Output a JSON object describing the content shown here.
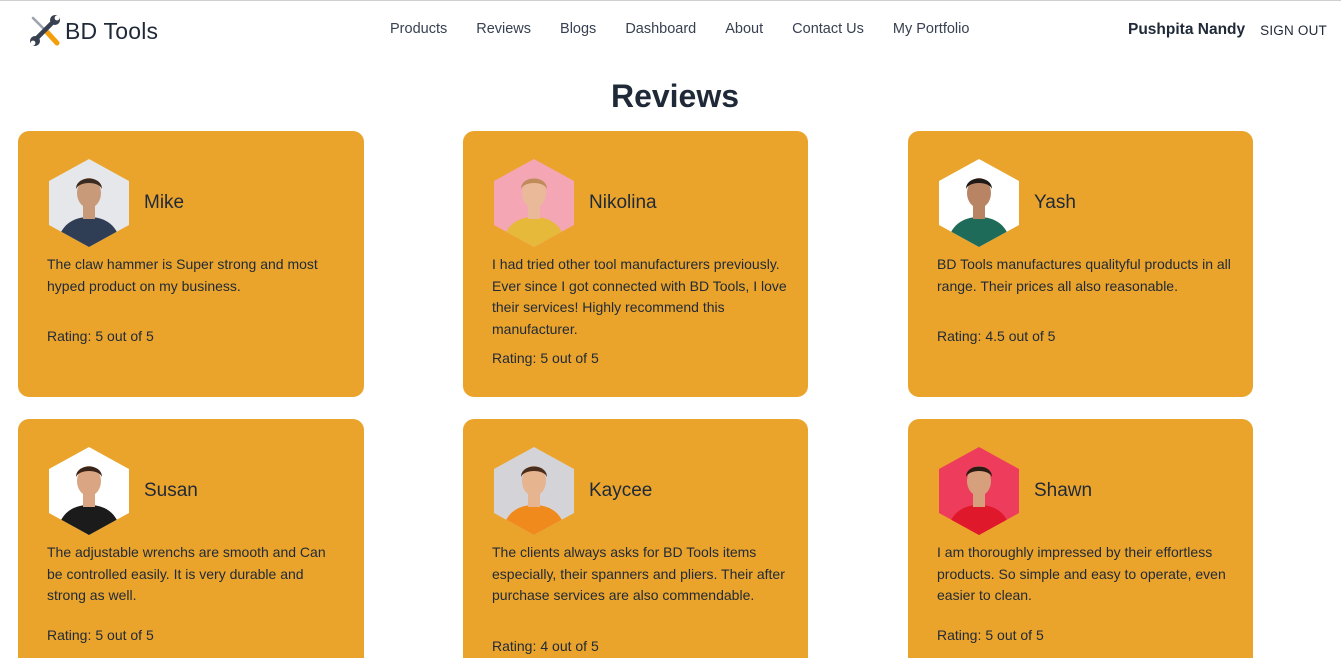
{
  "brand": {
    "name": "BD Tools",
    "logo_icon": "wrench-screwdriver-icon"
  },
  "nav": {
    "links": [
      "Products",
      "Reviews",
      "Blogs",
      "Dashboard",
      "About",
      "Contact Us",
      "My Portfolio"
    ],
    "user_name": "Pushpita Nandy",
    "signout_label": "SIGN OUT"
  },
  "page_title": "Reviews",
  "colors": {
    "card_bg": "#eba42b",
    "text": "#1f2937"
  },
  "reviews": [
    {
      "name": "Mike",
      "text": "The claw hammer is Super strong and most hyped product on my business.",
      "rating_label": "Rating:",
      "rating_value": "5 out of 5",
      "avatar_bg": "#e5e7eb",
      "shirt": "#2f3d55",
      "skin": "#c89a7a",
      "hair": "#3b2a1f"
    },
    {
      "name": "Nikolina",
      "text": "I had tried other tool manufacturers previously. Ever since I got connected with BD Tools, I love their services! Highly recommend this manufacturer.",
      "rating_label": "Rating:",
      "rating_value": "5 out of 5",
      "avatar_bg": "#f4a6b4",
      "shirt": "#e7b93a",
      "skin": "#e9b99a",
      "hair": "#c08a5a"
    },
    {
      "name": "Yash",
      "text": "BD Tools manufactures qualityful products in all range. Their prices all also reasonable.",
      "rating_label": "Rating:",
      "rating_value": "4.5 out of 5",
      "avatar_bg": "#ffffff",
      "shirt": "#1f6b5a",
      "skin": "#b98464",
      "hair": "#1f1a17"
    },
    {
      "name": "Susan",
      "text": "The adjustable wrenchs are smooth and Can be controlled easily. It is very durable and strong as well.",
      "rating_label": "Rating:",
      "rating_value": "5 out of 5",
      "avatar_bg": "#ffffff",
      "shirt": "#1b1b1b",
      "skin": "#d9a582",
      "hair": "#3a2419"
    },
    {
      "name": "Kaycee",
      "text": "The clients always asks for BD Tools items especially, their spanners and pliers. Their after purchase services are also commendable.",
      "rating_label": "Rating:",
      "rating_value": "4 out of 5",
      "avatar_bg": "#d4d4d8",
      "shirt": "#f08a1c",
      "skin": "#e6b48f",
      "hair": "#4a2e1d"
    },
    {
      "name": "Shawn",
      "text": "I am thoroughly impressed by their effortless products. So simple and easy to operate, even easier to clean.",
      "rating_label": "Rating:",
      "rating_value": "5 out of 5",
      "avatar_bg": "#ee3d5c",
      "shirt": "#e0182c",
      "skin": "#d7a07c",
      "hair": "#2a1c14"
    }
  ]
}
